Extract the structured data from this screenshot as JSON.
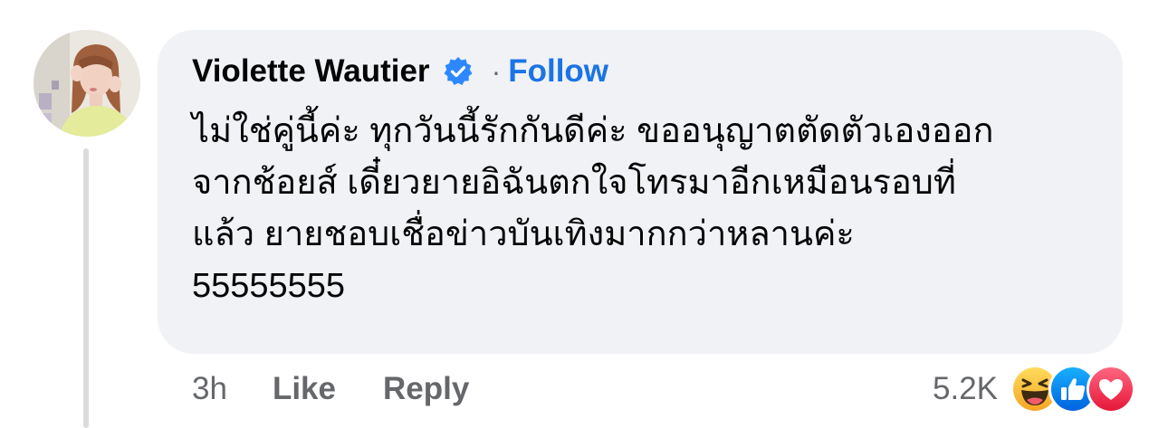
{
  "comment": {
    "author": "Violette Wautier",
    "verified_icon": "verified-badge-icon",
    "separator": "·",
    "follow_label": "Follow",
    "text_lines": [
      "ไม่ใช่คู่นี้ค่ะ ทุกวันนี้รักกันดีค่ะ ขออนุญาตตัดตัวเองออก",
      "จากช้อยส์ เดี๋ยวยายอิฉันตกใจโทรมาอีกเหมือนรอบที่",
      "แล้ว ยายชอบเชื่อข่าวบันเทิงมากกว่าหลานค่ะ",
      "55555555"
    ],
    "time": "3h",
    "like_label": "Like",
    "reply_label": "Reply",
    "reaction_count": "5.2K",
    "reactions": [
      "haha-icon",
      "like-icon",
      "love-icon"
    ]
  },
  "colors": {
    "bubble_bg": "#f0f2f5",
    "follow_blue": "#1b74e4",
    "meta_gray": "#65676b",
    "verified_blue": "#2d88ff",
    "love_red": "#f33e58",
    "haha_yellow": "#f7b125"
  }
}
